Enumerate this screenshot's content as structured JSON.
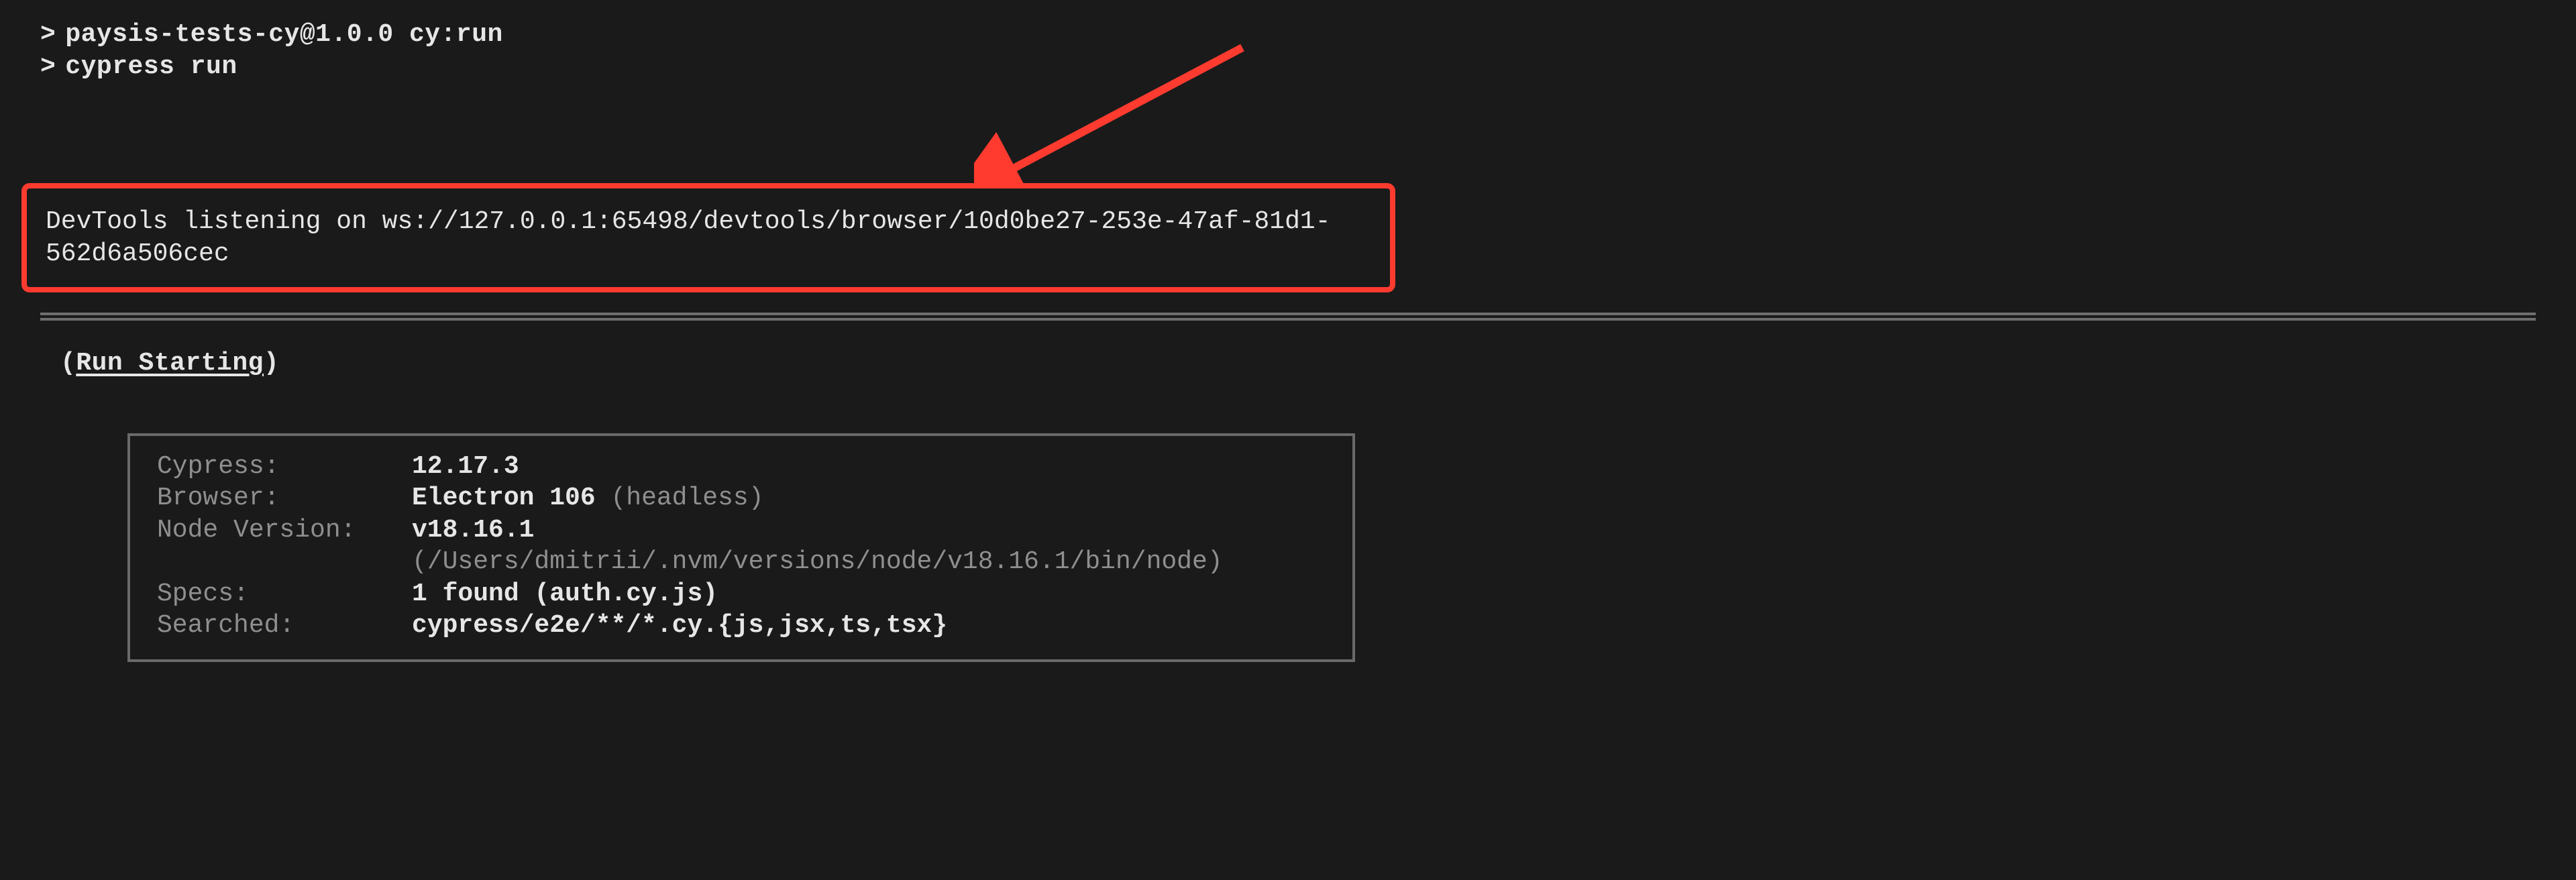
{
  "cmd": {
    "caret": ">",
    "line1": "paysis-tests-cy@1.0.0 cy:run",
    "line2": "cypress run"
  },
  "devtools": "DevTools listening on ws://127.0.0.1:65498/devtools/browser/10d0be27-253e-47af-81d1-562d6a506cec",
  "header": {
    "open": "(",
    "title": "Run Starting",
    "close": ")"
  },
  "info": {
    "cypress_label": "Cypress:",
    "cypress_val": "12.17.3",
    "browser_label": "Browser:",
    "browser_val": "Electron 106",
    "browser_dim": " (headless)",
    "node_label": "Node Version:",
    "node_val": "v18.16.1",
    "node_dim": " (/Users/dmitrii/.nvm/versions/node/v18.16.1/bin/node)",
    "specs_label": "Specs:",
    "specs_val": "1 found (auth.cy.js)",
    "searched_label": "Searched:",
    "searched_val": "cypress/e2e/**/*.cy.{js,jsx,ts,tsx}"
  }
}
